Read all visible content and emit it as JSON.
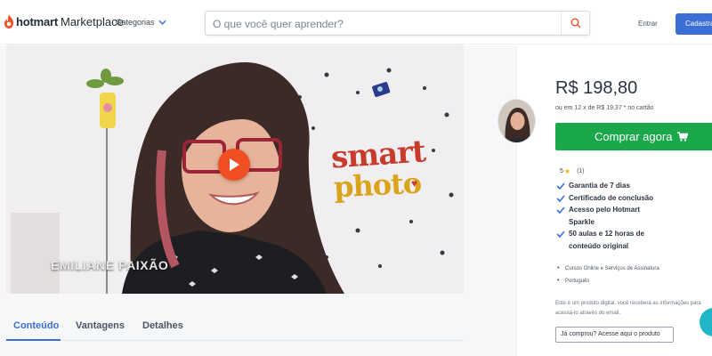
{
  "header": {
    "brand_bold": "hotmart",
    "brand_regular": "Marketplace",
    "categories_label": "Categorias",
    "search_placeholder": "O que você quer aprender?",
    "enter_label": "Entrar",
    "signup_label": "Cadastrar"
  },
  "video": {
    "caption": "EMILIANE PAIXÃO",
    "brand_line1": "smart",
    "brand_line2": "photo"
  },
  "tabs": [
    {
      "label": "Conteúdo",
      "active": true
    },
    {
      "label": "Vantagens",
      "active": false
    },
    {
      "label": "Detalhes",
      "active": false
    }
  ],
  "product": {
    "price": "R$ 198,80",
    "installments": "ou em 12 x de R$ 19,37 * no cartão",
    "buy_label": "Comprar agora",
    "rating_value": "5",
    "rating_count": "(1)",
    "features": [
      "Garantia de 7 dias",
      "Certificado de conclusão",
      "Acesso pelo Hotmart Sparkle",
      "50 aulas e 12 horas de conteúdo original"
    ],
    "meta": [
      "Cursos Online e Serviços de Assinatura",
      "Português"
    ],
    "disclaimer": "Este é um produto digital, você receberá as informações para acessá-lo através do email.",
    "bought_label": "Já comprou? Acesse aqui o produto"
  },
  "colors": {
    "accent_blue": "#3c6fd6",
    "buy_green": "#1aa84a",
    "brand_orange": "#f04e23",
    "chat_teal": "#1fb6c8"
  },
  "icons": [
    "hotmart-flame-icon",
    "chevron-down-icon",
    "search-icon",
    "play-icon",
    "cart-icon",
    "star-icon",
    "check-icon",
    "chat-icon"
  ]
}
